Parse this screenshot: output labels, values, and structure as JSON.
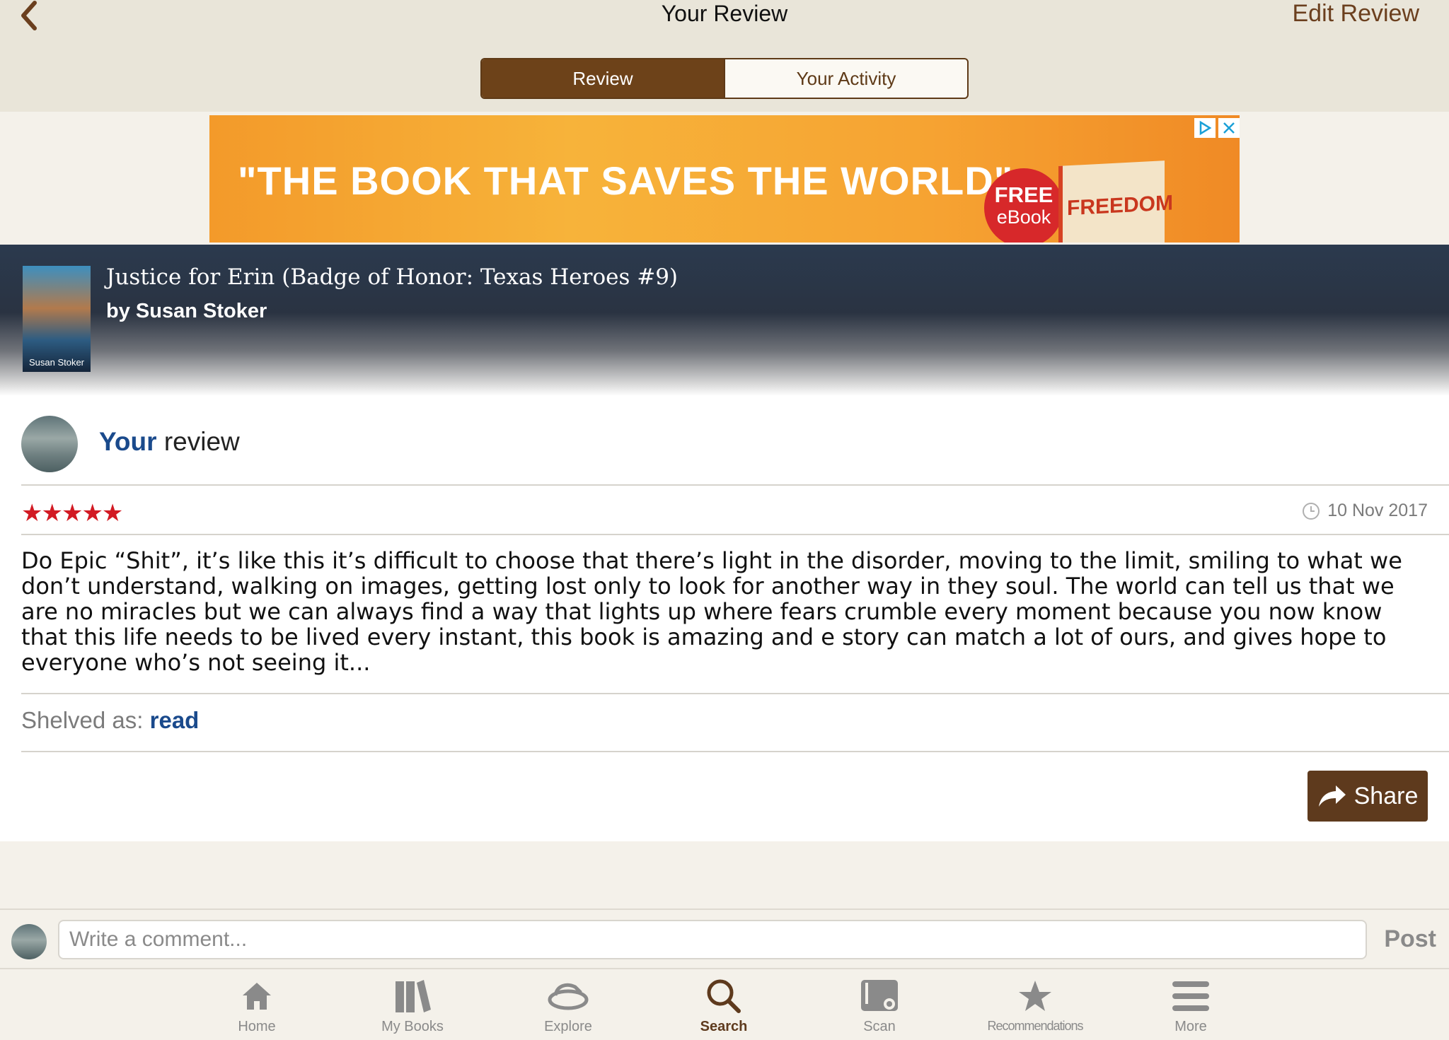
{
  "header": {
    "title": "Your Review",
    "edit_label": "Edit Review",
    "tabs": [
      {
        "label": "Review",
        "active": true
      },
      {
        "label": "Your Activity",
        "active": false
      }
    ]
  },
  "ad": {
    "headline": "\"THE BOOK THAT SAVES THE WORLD\"",
    "badge_free": "FREE",
    "badge_ebook": "eBook",
    "book_cover_title": "FREEDOM"
  },
  "book": {
    "title": "Justice for Erin (Badge of Honor: Texas Heroes #9)",
    "author": "by Susan Stoker",
    "cover_author": "Susan Stoker"
  },
  "review": {
    "your_label": "Your",
    "review_label": "review",
    "rating": 5,
    "stars": "★★★★★",
    "date": "10 Nov 2017",
    "text": "Do Epic “Shit”, it’s like this it’s difficult to choose that there’s light in the disorder, moving to the limit, smiling to what we don’t understand, walking on images, getting lost only to look for another way in they soul. The world can tell us that we are no miracles but we can always find a way that lights up where fears crumble every moment because you now know that this life needs to be lived every instant, this book is amazing and e story can match a lot of ours, and gives hope to everyone who’s not seeing it...",
    "shelved_label": "Shelved as:",
    "shelf": "read",
    "share_label": "Share"
  },
  "comment": {
    "placeholder": "Write a comment...",
    "value": "",
    "post_label": "Post"
  },
  "tabbar": {
    "items": [
      {
        "label": "Home",
        "icon": "home-icon",
        "active": false
      },
      {
        "label": "My Books",
        "icon": "books-icon",
        "active": false
      },
      {
        "label": "Explore",
        "icon": "explore-icon",
        "active": false
      },
      {
        "label": "Search",
        "icon": "search-icon",
        "active": true
      },
      {
        "label": "Scan",
        "icon": "scan-icon",
        "active": false
      },
      {
        "label": "Recommendations",
        "icon": "star-icon",
        "active": false
      },
      {
        "label": "More",
        "icon": "menu-icon",
        "active": false
      }
    ]
  },
  "colors": {
    "brand_brown": "#6d4219",
    "link_blue": "#1a4a8c",
    "star_red": "#d21a23",
    "background": "#f4f1ea"
  }
}
